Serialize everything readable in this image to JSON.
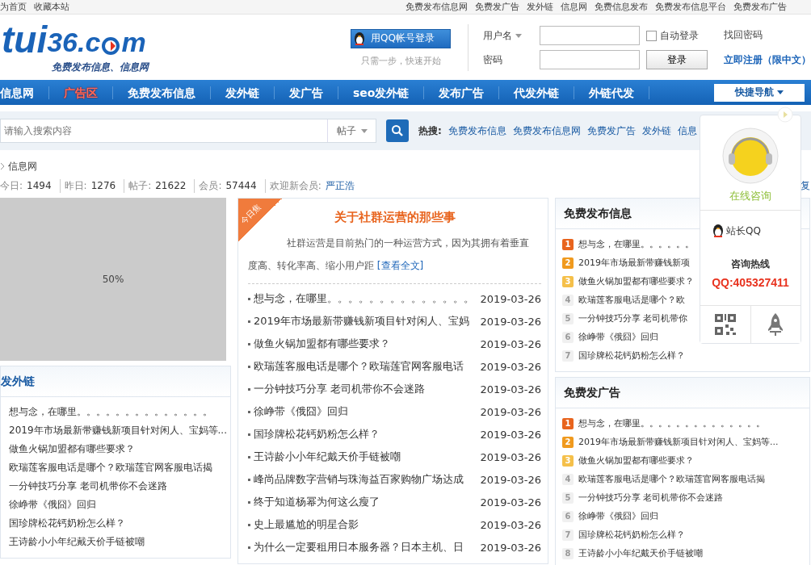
{
  "top_bar": {
    "left_links": [
      "为首页",
      "收藏本站"
    ],
    "right_links": [
      "免费发布信息网",
      "免费发广告",
      "发外链",
      "信息网",
      "免费信息发布",
      "免费发布信息平台",
      "免费发布广告"
    ]
  },
  "logo": {
    "main": "tui",
    "accent": "36.c",
    "end": "m",
    "slogan": "免费发布信息、信息网"
  },
  "qq_login": {
    "button": "用QQ帐号登录",
    "hint": "只需一步，快速开始"
  },
  "login": {
    "username_label": "用户名",
    "password_label": "密码",
    "auto_login": {
      "label": "自动登录",
      "checked": false
    },
    "submit": "登录",
    "forgot": "找回密码",
    "register": "立即注册（限中文）"
  },
  "nav": {
    "items": [
      {
        "label": "信息网",
        "selected": false
      },
      {
        "label": "广告区",
        "selected": true
      },
      {
        "label": "免费发布信息",
        "selected": false
      },
      {
        "label": "发外链",
        "selected": false
      },
      {
        "label": "发广告",
        "selected": false
      },
      {
        "label": "seo发外链",
        "selected": false
      },
      {
        "label": "发布广告",
        "selected": false
      },
      {
        "label": "代发外链",
        "selected": false
      },
      {
        "label": "外链代发",
        "selected": false
      }
    ],
    "quick": "快捷导航"
  },
  "search": {
    "placeholder": "请输入搜索内容",
    "scope": "帖子",
    "hot_label": "热搜:",
    "hot": [
      "免费发布信息",
      "免费发布信息网",
      "免费发广告",
      "发外链",
      "信息"
    ]
  },
  "breadcrumb": "信息网",
  "stats": {
    "items": [
      {
        "label": "今日:",
        "value": "1494"
      },
      {
        "label": "昨日:",
        "value": "1276"
      },
      {
        "label": "帖子:",
        "value": "21622"
      },
      {
        "label": "会员:",
        "value": "57444"
      }
    ],
    "new_member_label": "欢迎新会员:",
    "new_member": "严正浩",
    "tail": "复"
  },
  "slideshow": {
    "text": "50%"
  },
  "left_box": {
    "title": "发外链",
    "items": [
      "想与念，在哪里。。。。。。。。。。。。。。",
      "2019年市场最新带赚钱新项目针对闲人、宝妈等...",
      "做鱼火锅加盟都有哪些要求？",
      "欧瑞莲客服电话是哪个？欧瑞莲官网客服电话揭",
      "一分钟技巧分享 老司机带你不会迷路",
      "徐峥带《俄囧》回归",
      "国珍牌松花钙奶粉怎么样？",
      "王诗龄小小年纪戴天价手链被嘲"
    ]
  },
  "featured": {
    "ribbon": "今日焦",
    "title": "关于社群运营的那些事",
    "summary": "社群运营是目前热门的一种运营方式，因为其拥有着垂直度高、转化率高、缩小用户距",
    "more": "[查看全文]",
    "rows": [
      {
        "title": "想与念，在哪里。。。。。。。。。。。。。。",
        "date": "2019-03-26"
      },
      {
        "title": "2019年市场最新带赚钱新项目针对闲人、宝妈",
        "date": "2019-03-26"
      },
      {
        "title": "做鱼火锅加盟都有哪些要求？",
        "date": "2019-03-26"
      },
      {
        "title": "欧瑞莲客服电话是哪个？欧瑞莲官网客服电话",
        "date": "2019-03-26"
      },
      {
        "title": "一分钟技巧分享 老司机带你不会迷路",
        "date": "2019-03-26"
      },
      {
        "title": "徐峥带《俄囧》回归",
        "date": "2019-03-26"
      },
      {
        "title": "国珍牌松花钙奶粉怎么样？",
        "date": "2019-03-26"
      },
      {
        "title": "王诗龄小小年纪戴天价手链被嘲",
        "date": "2019-03-26"
      },
      {
        "title": "峰尚品牌数字营销与珠海益百家购物广场达成",
        "date": "2019-03-26"
      },
      {
        "title": "终于知道杨幂为何这么瘦了",
        "date": "2019-03-26"
      },
      {
        "title": "史上最尴尬的明星合影",
        "date": "2019-03-26"
      },
      {
        "title": "为什么一定要租用日本服务器？日本主机、日",
        "date": "2019-03-26"
      }
    ]
  },
  "right_boxes": [
    {
      "title": "免费发布信息",
      "items": [
        {
          "rank": "1",
          "kind": "hot",
          "color": "#e8641e",
          "text": "想与念，在哪里。。。。。。"
        },
        {
          "rank": "2",
          "kind": "hot",
          "color": "#f09a1e",
          "text": "2019年市场最新带赚钱新项"
        },
        {
          "rank": "3",
          "kind": "hot",
          "color": "#f5c04a",
          "text": "做鱼火锅加盟都有哪些要求？"
        },
        {
          "rank": "4",
          "kind": "plain",
          "color": "#f0f0f0",
          "text": "欧瑞莲客服电话是哪个？欧"
        },
        {
          "rank": "5",
          "kind": "plain",
          "color": "#f0f0f0",
          "text": "一分钟技巧分享 老司机带你"
        },
        {
          "rank": "6",
          "kind": "plain",
          "color": "#f0f0f0",
          "text": "徐峥带《俄囧》回归"
        },
        {
          "rank": "7",
          "kind": "plain",
          "color": "#f0f0f0",
          "text": "国珍牌松花钙奶粉怎么样？"
        }
      ]
    },
    {
      "title": "免费发广告",
      "items": [
        {
          "rank": "1",
          "kind": "hot",
          "color": "#e8641e",
          "text": "想与念，在哪里。。。。。。。。。。。。。。"
        },
        {
          "rank": "2",
          "kind": "hot",
          "color": "#f09a1e",
          "text": "2019年市场最新带赚钱新项目针对闲人、宝妈等..."
        },
        {
          "rank": "3",
          "kind": "hot",
          "color": "#f5c04a",
          "text": "做鱼火锅加盟都有哪些要求？"
        },
        {
          "rank": "4",
          "kind": "plain",
          "color": "#f0f0f0",
          "text": "欧瑞莲客服电话是哪个？欧瑞莲官网客服电话揭"
        },
        {
          "rank": "5",
          "kind": "plain",
          "color": "#f0f0f0",
          "text": "一分钟技巧分享 老司机带你不会迷路"
        },
        {
          "rank": "6",
          "kind": "plain",
          "color": "#f0f0f0",
          "text": "徐峥带《俄囧》回归"
        },
        {
          "rank": "7",
          "kind": "plain",
          "color": "#f0f0f0",
          "text": "国珍牌松花钙奶粉怎么样？"
        },
        {
          "rank": "8",
          "kind": "plain",
          "color": "#f0f0f0",
          "text": "王诗龄小小年纪戴天价手链被嘲"
        }
      ]
    }
  ],
  "float_panel": {
    "label": "在线咨询",
    "qq_label": "站长QQ",
    "hotline_label": "咨询热线",
    "hotline": "QQ:405327411"
  }
}
